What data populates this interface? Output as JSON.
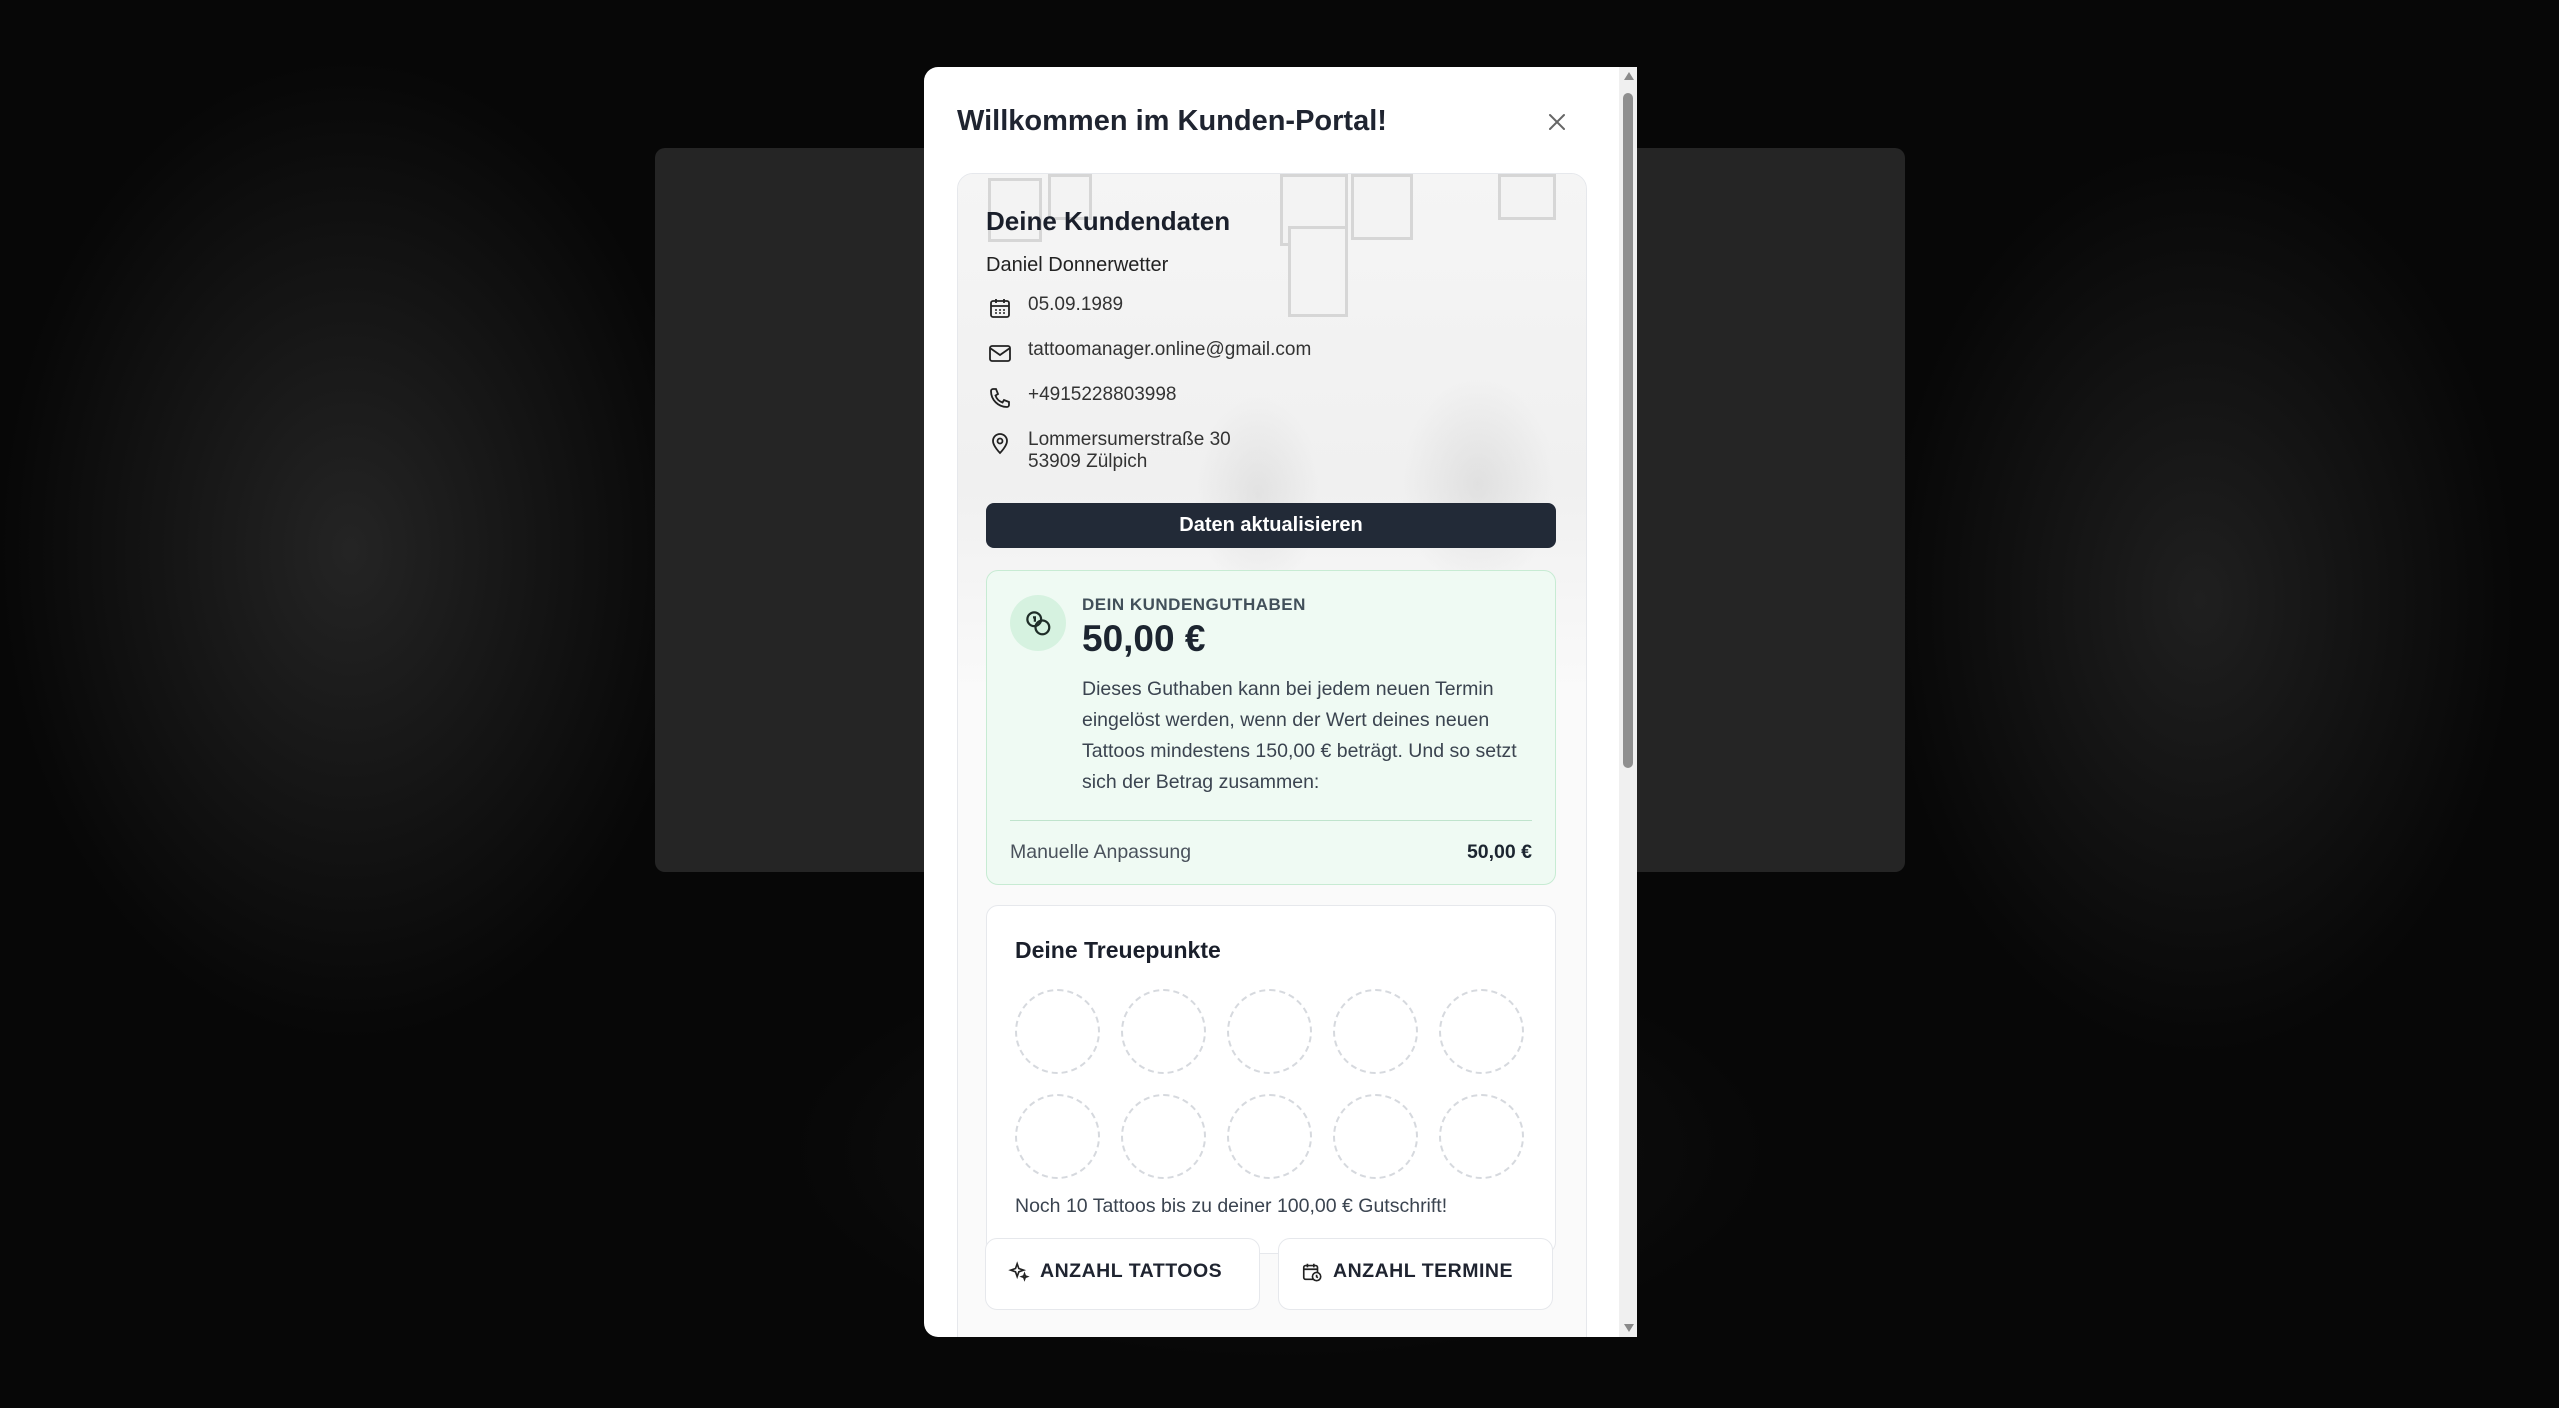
{
  "modal": {
    "title": "Willkommen im Kunden-Portal!",
    "close_icon": "close-icon"
  },
  "customer": {
    "section_title": "Deine Kundendaten",
    "name": "Daniel Donnerwetter",
    "birthdate": "05.09.1989",
    "email": "tattoomanager.online@gmail.com",
    "phone": "+4915228803998",
    "address_line1": "Lommersumerstraße 30",
    "address_line2": "53909 Zülpich",
    "update_button": "Daten aktualisieren"
  },
  "credit": {
    "label": "DEIN KUNDENGUTHABEN",
    "amount": "50,00 €",
    "description": "Dieses Guthaben kann bei jedem neuen Termin eingelöst werden, wenn der Wert deines neuen Tattoos mindestens 150,00 € beträgt. Und so setzt sich der Betrag zusammen:",
    "rows": [
      {
        "label": "Manuelle Anpassung",
        "value": "50,00 €"
      }
    ],
    "accent_color": "#effaf3"
  },
  "loyalty": {
    "title": "Deine Treuepunkte",
    "stamps_total": 10,
    "stamps_filled": 0,
    "message": "Noch 10 Tattoos bis zu deiner 100,00 € Gutschrift!"
  },
  "stats": [
    {
      "label": "ANZAHL TATTOOS",
      "icon": "sparkles-icon"
    },
    {
      "label": "ANZAHL TERMINE",
      "icon": "calendar-clock-icon"
    }
  ],
  "colors": {
    "primary_button": "#222a37",
    "text_dark": "#1a1f2b"
  }
}
